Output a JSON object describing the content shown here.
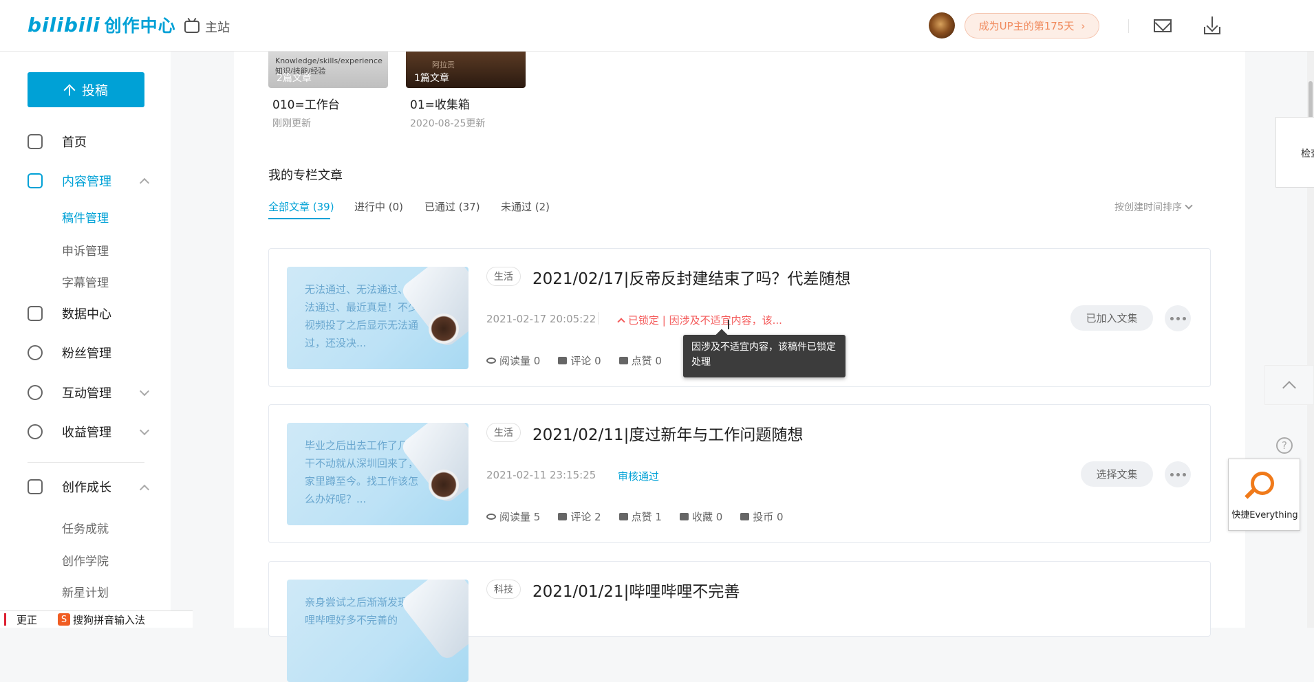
{
  "header": {
    "logo_brand": "bilibili",
    "logo_center": "创作中心",
    "main_site": "主站",
    "up_days": "成为UP主的第175天",
    "up_days_arrow": "›"
  },
  "sidebar": {
    "upload": "投稿",
    "items": [
      {
        "label": "首页"
      },
      {
        "label": "内容管理"
      },
      {
        "label": "数据中心"
      },
      {
        "label": "粉丝管理"
      },
      {
        "label": "互动管理"
      },
      {
        "label": "收益管理"
      },
      {
        "label": "创作成长"
      }
    ],
    "content_sub": [
      "稿件管理",
      "申诉管理",
      "字幕管理"
    ],
    "growth_sub": [
      "任务成就",
      "创作学院",
      "新星计划"
    ]
  },
  "collections": [
    {
      "count": "2篇文章",
      "name": "010=工作台",
      "date": "刚刚更新",
      "thumb_text": "Knowledge/skills/experience 知识/技能/经验"
    },
    {
      "count": "1篇文章",
      "name": "01=收集箱",
      "date": "2020-08-25更新",
      "thumb_text": "阿拉贡"
    }
  ],
  "articles_section": {
    "title": "我的专栏文章",
    "tabs": [
      "全部文章 (39)",
      "进行中 (0)",
      "已通过 (37)",
      "未通过 (2)"
    ],
    "sort": "按创建时间排序"
  },
  "articles": [
    {
      "cover_text": "无法通过、无法通过、无法通过、最近真是！不少视频投了之后显示无法通过，还没决...",
      "tag": "生活",
      "title": "2021/02/17|反帝反封建结束了吗？代差随想",
      "date": "2021-02-17 20:05:22",
      "status": "已锁定 | 因涉及不适宜内容，该...",
      "stats": [
        "阅读量 0",
        "评论 0",
        "点赞 0"
      ],
      "action": "已加入文集"
    },
    {
      "cover_text": "毕业之后出去工作了几天干不动就从深圳回来了，家里蹲至今。找工作该怎么办好呢？...",
      "tag": "生活",
      "title": "2021/02/11|度过新年与工作问题随想",
      "date": "2021-02-11 23:15:25",
      "status": "审核通过",
      "stats": [
        "阅读量 5",
        "评论 2",
        "点赞 1",
        "收藏 0",
        "投币 0"
      ],
      "action": "选择文集"
    },
    {
      "cover_text": "亲身尝试之后渐渐发现哔哩哔哩好多不完善的",
      "tag": "科技",
      "title": "2021/01/21|哔哩哔哩不完善"
    }
  ],
  "tooltip": "因涉及不适宜内容，该稿件已锁定处理",
  "float_panel": "检查",
  "everything": "快捷Everything",
  "help": "?",
  "ime": {
    "fix": "更正",
    "logo": "S",
    "name": "搜狗拼音输入法"
  },
  "colors": {
    "accent": "#00a1d6",
    "locked": "#f45a5a",
    "up_pill": "#f08a5d"
  }
}
